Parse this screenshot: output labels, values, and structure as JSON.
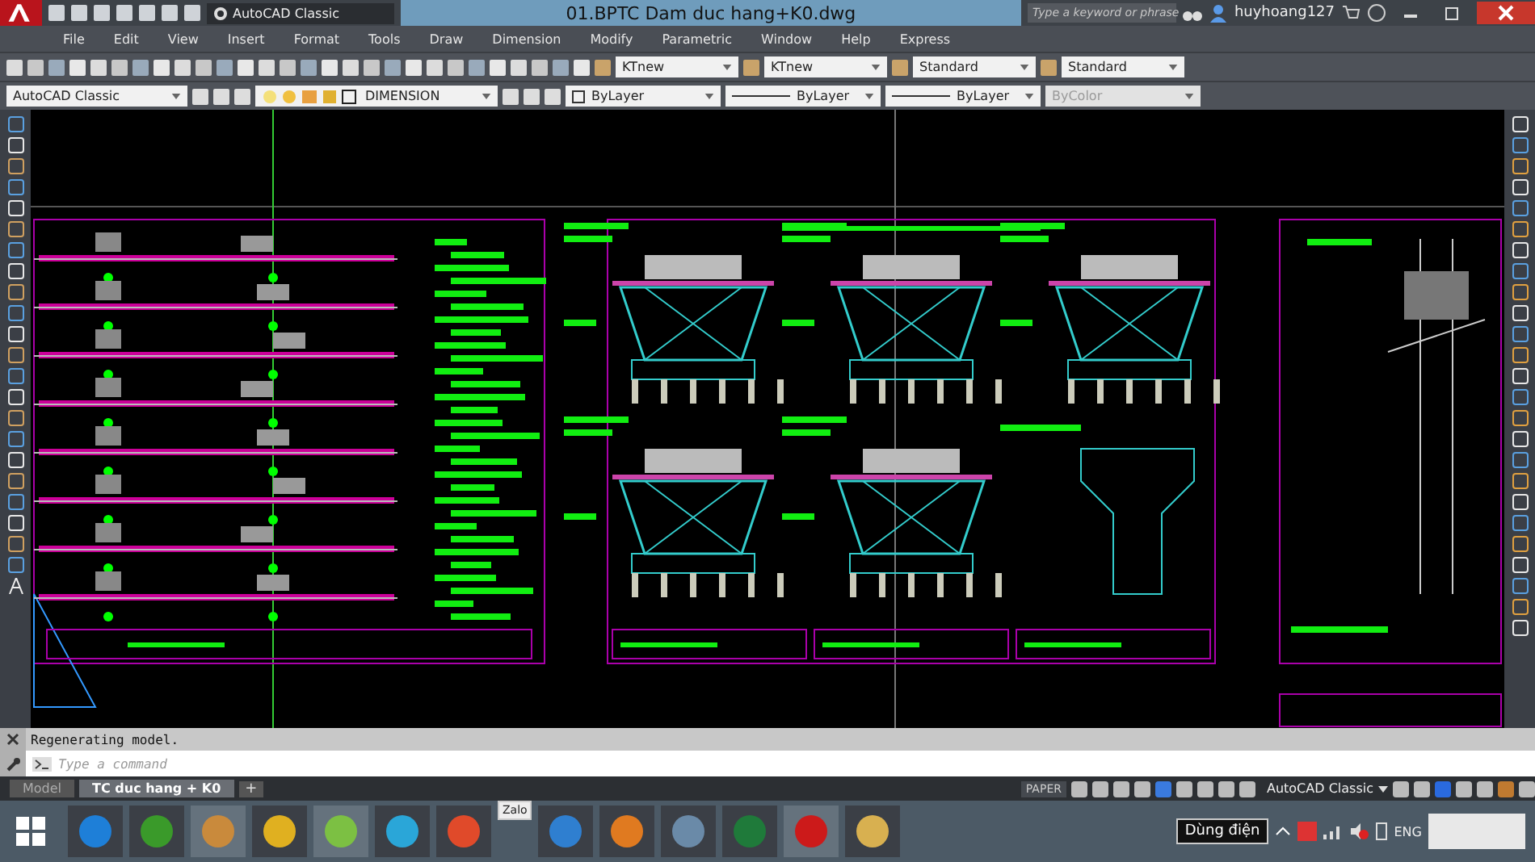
{
  "title_bar": {
    "workspace": "AutoCAD Classic",
    "title": "01.BPTC Dam duc hang+K0.dwg",
    "search": {
      "placeholder": "Type a keyword or phrase"
    },
    "user": "huyhoang127"
  },
  "menu": [
    "File",
    "Edit",
    "View",
    "Insert",
    "Format",
    "Tools",
    "Draw",
    "Dimension",
    "Modify",
    "Parametric",
    "Window",
    "Help",
    "Express"
  ],
  "style_dropdowns": [
    {
      "value": "KTnew"
    },
    {
      "value": "KTnew"
    },
    {
      "value": "Standard"
    },
    {
      "value": "Standard"
    }
  ],
  "properties_bar": {
    "workspace": "AutoCAD Classic",
    "layer": "DIMENSION",
    "color": {
      "value": "ByLayer",
      "disabled": false
    },
    "linetype": {
      "value": "ByLayer",
      "disabled": false
    },
    "lineweight": {
      "value": "ByLayer",
      "disabled": false
    },
    "plot_style": {
      "value": "ByColor",
      "disabled": true
    }
  },
  "command_history": [
    "Regenerating model."
  ],
  "command_line": {
    "placeholder": "Type a command"
  },
  "layout_tabs": [
    {
      "label": "Model",
      "selected": false
    },
    {
      "label": "TC duc hang + K0",
      "selected": true
    }
  ],
  "add_tab": "+",
  "status_bar": {
    "space": "PAPER",
    "workspace": "AutoCAD Classic"
  },
  "taskbar": {
    "tooltip": "Zalo",
    "tray_tooltip": "Dùng điện",
    "language": "ENG"
  }
}
